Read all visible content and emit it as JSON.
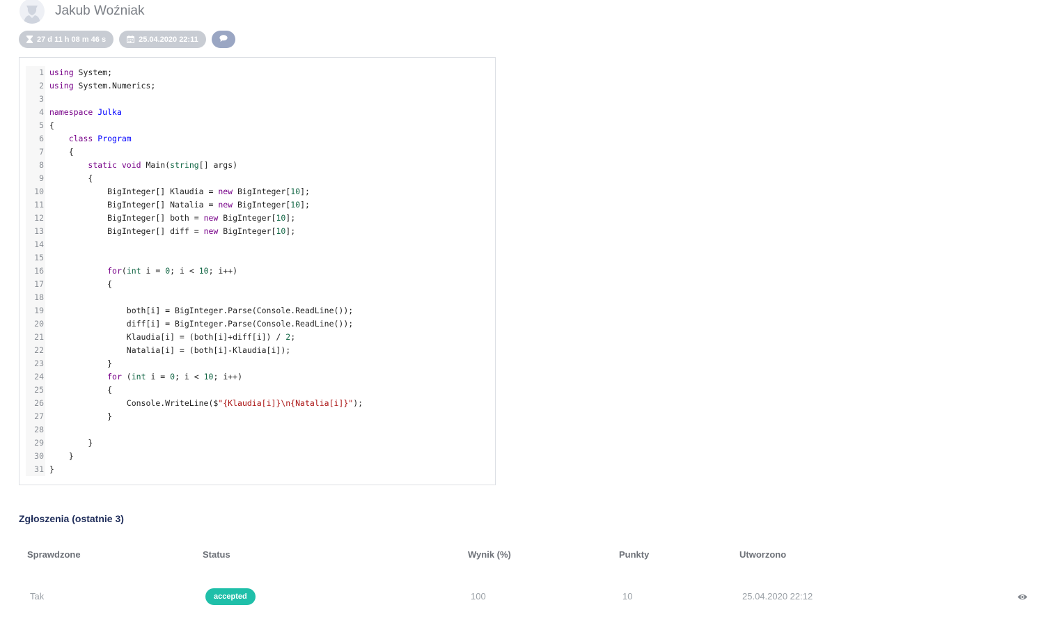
{
  "user": {
    "name": "Jakub Woźniak",
    "avatar_icon": "user-avatar-icon"
  },
  "badges": {
    "time_left": "27 d 11 h 08 m 46 s",
    "time_icon": "hourglass-icon",
    "date": "25.04.2020 22:11",
    "date_icon": "calendar-icon",
    "comment_icon": "comment-icon"
  },
  "code": {
    "lines": [
      "using System;",
      "using System.Numerics;",
      "",
      "namespace Julka",
      "{",
      "    class Program",
      "    {",
      "        static void Main(string[] args)",
      "        {",
      "            BigInteger[] Klaudia = new BigInteger[10];",
      "            BigInteger[] Natalia = new BigInteger[10];",
      "            BigInteger[] both = new BigInteger[10];",
      "            BigInteger[] diff = new BigInteger[10];",
      "",
      "",
      "            for(int i = 0; i < 10; i++)",
      "            {",
      "",
      "                both[i] = BigInteger.Parse(Console.ReadLine());",
      "                diff[i] = BigInteger.Parse(Console.ReadLine());",
      "                Klaudia[i] = (both[i]+diff[i]) / 2;",
      "                Natalia[i] = (both[i]-Klaudia[i]);",
      "            }",
      "            for (int i = 0; i < 10; i++)",
      "            {",
      "                Console.WriteLine($\"{Klaudia[i]}\\n{Natalia[i]}\");",
      "            }",
      "",
      "        }",
      "    }",
      "}"
    ]
  },
  "submissions": {
    "title": "Zgłoszenia (ostatnie 3)",
    "columns": [
      "Sprawdzone",
      "Status",
      "Wynik (%)",
      "Punkty",
      "Utworzono"
    ],
    "rows": [
      {
        "checked": "Tak",
        "status": "accepted",
        "score": "100",
        "points": "10",
        "created": "25.04.2020 22:12",
        "action_icon": "eye-icon"
      }
    ]
  },
  "colors": {
    "accent": "#1fbfa9",
    "title": "#1f2d5a",
    "badge": "#c8ccd3",
    "badge_comment": "#9aa6c3"
  }
}
